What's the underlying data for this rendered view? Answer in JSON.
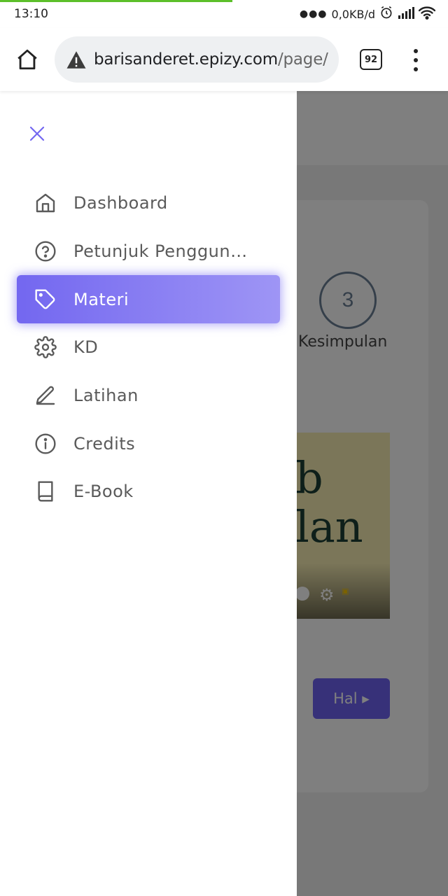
{
  "status_bar": {
    "time": "13:10",
    "network_speed": "0,0KB/d",
    "icons": [
      "alarm-icon",
      "signal-icon",
      "wifi-icon"
    ]
  },
  "browser": {
    "url_host": "barisanderet.epizy.com",
    "url_path": "/page/",
    "tab_count": "92",
    "security_icon": "warning-triangle-icon"
  },
  "drawer": {
    "close_icon": "close-icon",
    "items": [
      {
        "label": "Dashboard",
        "icon": "home-icon",
        "active": false
      },
      {
        "label": "Petunjuk Penggun…",
        "icon": "help-circle-icon",
        "active": false
      },
      {
        "label": "Materi",
        "icon": "tag-icon",
        "active": true
      },
      {
        "label": "KD",
        "icon": "settings-icon",
        "active": false
      },
      {
        "label": "Latihan",
        "icon": "edit-icon",
        "active": false
      },
      {
        "label": "Credits",
        "icon": "info-icon",
        "active": false
      },
      {
        "label": "E-Book",
        "icon": "book-icon",
        "active": false
      }
    ]
  },
  "background": {
    "step_number": "3",
    "step_label": "Kesimpulan",
    "video_text_line1": "b",
    "video_text_line2": "lan",
    "next_button": "Hal ▸"
  },
  "colors": {
    "accent": "#7367f0",
    "load_progress": "#5cbf2a"
  }
}
